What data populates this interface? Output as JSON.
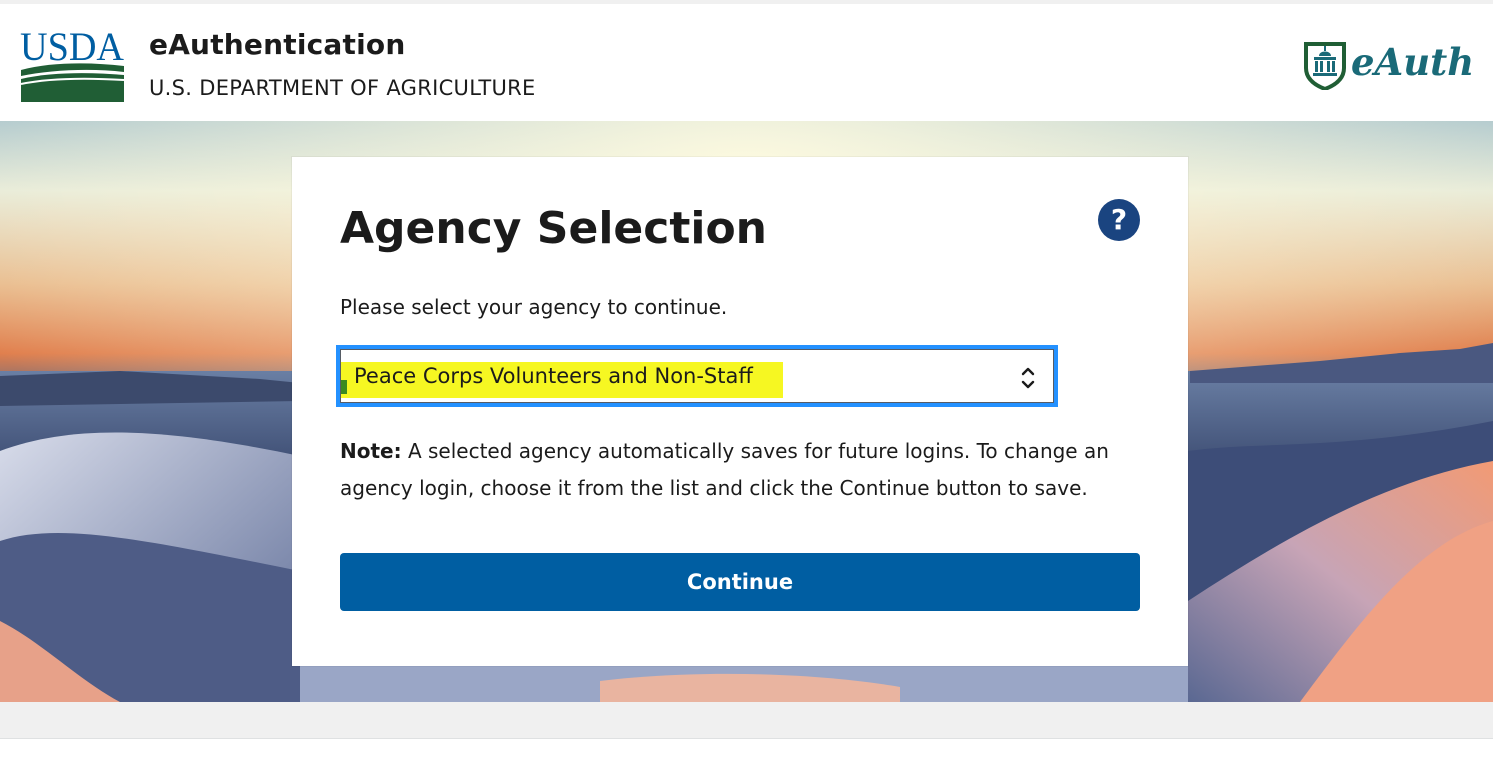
{
  "header": {
    "logo_text": "USDA",
    "app_title": "eAuthentication",
    "app_subtitle": "U.S. DEPARTMENT OF AGRICULTURE",
    "brand_logo_text": "eAuth"
  },
  "card": {
    "title": "Agency Selection",
    "help_icon_glyph": "?",
    "instructions": "Please select your agency to continue.",
    "agency_select": {
      "selected_value": "Peace Corps Volunteers and Non-Staff"
    },
    "note_label": "Note:",
    "note_text": " A selected agency automatically saves for future logins. To change an agency login, choose it from the list and click the Continue button to save.",
    "continue_label": "Continue"
  },
  "colors": {
    "usda_blue": "#005ea2",
    "usda_green": "#205e35",
    "help_icon": "#1a4480",
    "focus_ring": "#2491ff",
    "highlight": "#f6f722",
    "eauth_teal": "#1a6a78"
  },
  "icons": {
    "help": "question-circle-icon",
    "select": "chevron-up-down-icon",
    "brand": "capitol-shield-icon"
  }
}
